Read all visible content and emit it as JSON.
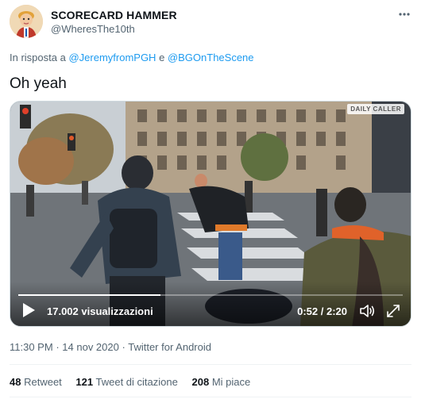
{
  "user": {
    "display_name": "SCORECARD HAMMER",
    "handle": "@WheresThe10th",
    "avatar_icon": "cartoon-avatar"
  },
  "more_icon": "more-options-icon",
  "reply": {
    "prefix": "In risposta a",
    "user1": "@JeremyfromPGH",
    "joiner": "e",
    "user2": "@BGOnTheScene"
  },
  "tweet_text": "Oh yeah",
  "video": {
    "watermark": "DAILY CALLER",
    "views": "17.002 visualizzazioni",
    "time": "0:52 / 2:20",
    "progress_fraction": 0.37,
    "play_icon": "play-icon",
    "volume_icon": "volume-icon",
    "fullscreen_icon": "fullscreen-icon"
  },
  "meta": {
    "time": "11:30 PM",
    "sep1": "·",
    "date": "14 nov 2020",
    "sep2": "·",
    "source": "Twitter for Android"
  },
  "stats": {
    "retweets_count": "48",
    "retweets_label": "Retweet",
    "quotes_count": "121",
    "quotes_label": "Tweet di citazione",
    "likes_count": "208",
    "likes_label": "Mi piace"
  },
  "colors": {
    "link": "#1d9bf0",
    "secondary": "#536471",
    "primary": "#0f1419"
  }
}
